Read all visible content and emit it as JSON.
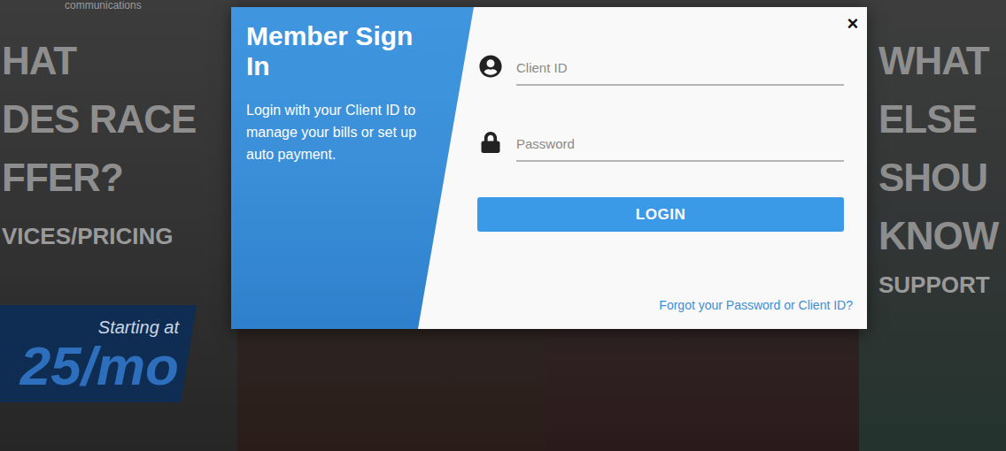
{
  "background": {
    "logo_text": "communications",
    "left_panel": {
      "heading_lines": [
        "HAT",
        "DES RACE",
        "FFER?"
      ],
      "link": "VICES/PRICING",
      "promo": {
        "label": "Starting at",
        "price": "25/mo"
      }
    },
    "right_panel": {
      "heading_lines": [
        "WHAT",
        "ELSE",
        "SHOU",
        "KNOW"
      ],
      "link": "SUPPORT"
    }
  },
  "dialog": {
    "title": "Member Sign In",
    "description": "Login with your Client ID to manage your bills or set up auto payment.",
    "close": "×",
    "fields": [
      {
        "placeholder": "Client ID",
        "kind": "text"
      },
      {
        "placeholder": "Password",
        "kind": "password"
      }
    ],
    "button": "LOGIN",
    "link": "Forgot your Password or Client ID?"
  }
}
